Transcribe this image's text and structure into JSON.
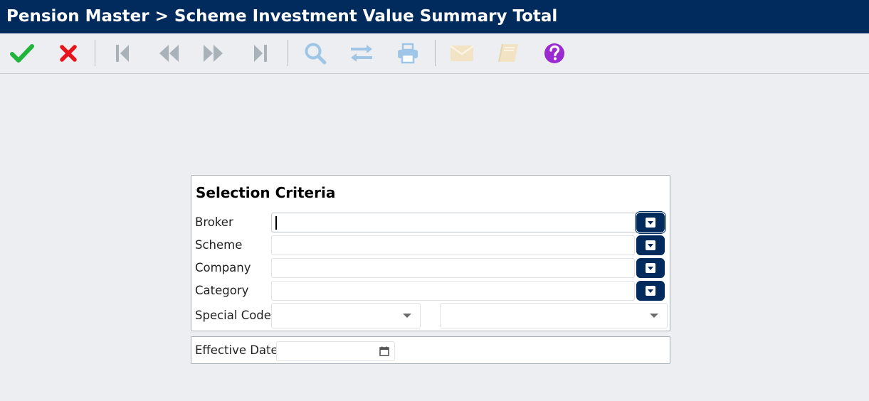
{
  "window": {
    "title": "Pension Master > Scheme Investment Value Summary Total"
  },
  "toolbar": {
    "buttons": [
      {
        "icon": "check-icon",
        "color": "#1fb53a"
      },
      {
        "icon": "close-icon",
        "color": "#e8141b"
      },
      {
        "icon": "first-record-icon",
        "color": "#a9b1b9"
      },
      {
        "icon": "previous-record-icon",
        "color": "#a9b1b9"
      },
      {
        "icon": "next-record-icon",
        "color": "#a9b1b9"
      },
      {
        "icon": "last-record-icon",
        "color": "#a9b1b9"
      },
      {
        "icon": "search-icon",
        "color": "#9fc6e6"
      },
      {
        "icon": "swap-icon",
        "color": "#9fc6e6"
      },
      {
        "icon": "print-icon",
        "color": "#9fc6e6"
      },
      {
        "icon": "mail-icon",
        "color": "#f1e3c4"
      },
      {
        "icon": "book-icon",
        "color": "#f1e3c4"
      },
      {
        "icon": "help-icon",
        "color": "#9a2bd0"
      }
    ]
  },
  "selection": {
    "title": "Selection Criteria",
    "broker": {
      "label": "Broker",
      "value": ""
    },
    "scheme": {
      "label": "Scheme",
      "value": ""
    },
    "company": {
      "label": "Company",
      "value": ""
    },
    "category": {
      "label": "Category",
      "value": ""
    },
    "special_code": {
      "label": "Special Code",
      "value1": "",
      "value2": ""
    }
  },
  "effective": {
    "label": "Effective Date",
    "value": ""
  },
  "colors": {
    "header_bg": "#002b5c",
    "lookup_button": "#002b5c"
  }
}
